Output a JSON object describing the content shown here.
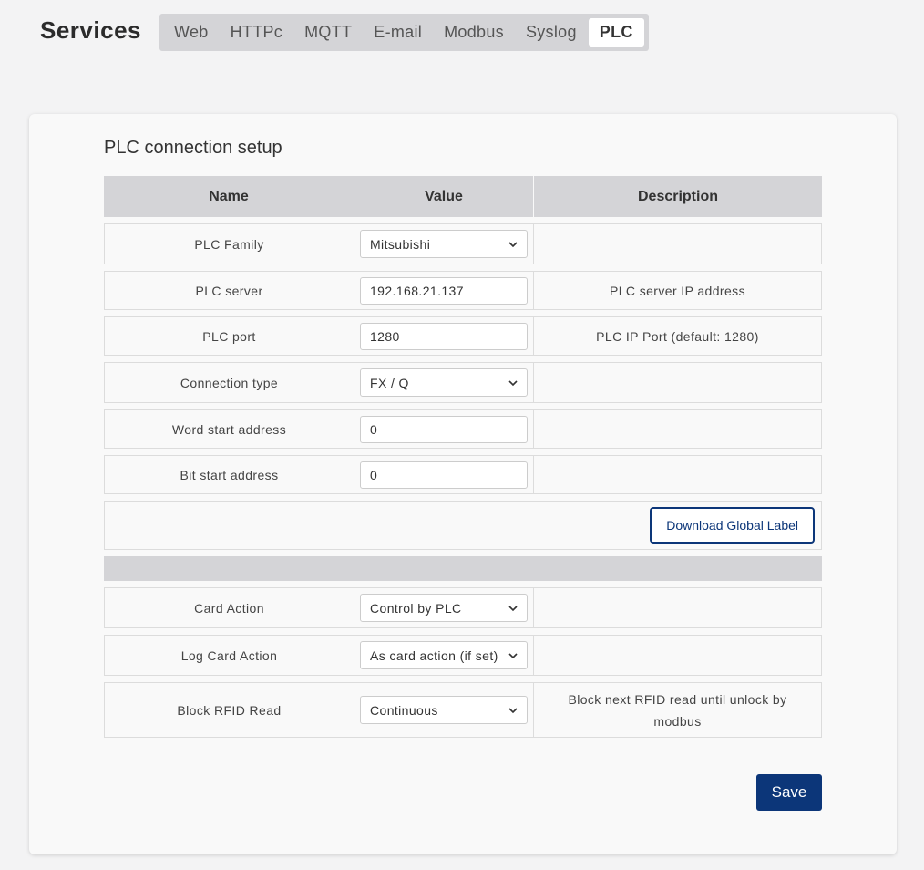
{
  "header": {
    "title": "Services",
    "tabs": [
      {
        "label": "Web"
      },
      {
        "label": "HTTPc"
      },
      {
        "label": "MQTT"
      },
      {
        "label": "E-mail"
      },
      {
        "label": "Modbus"
      },
      {
        "label": "Syslog"
      },
      {
        "label": "PLC",
        "active": true
      }
    ]
  },
  "section": {
    "title": "PLC connection setup",
    "columns": {
      "name": "Name",
      "value": "Value",
      "description": "Description"
    },
    "rows": [
      {
        "name": "PLC Family",
        "type": "select",
        "value": "Mitsubishi",
        "description": ""
      },
      {
        "name": "PLC server",
        "type": "input",
        "value": "192.168.21.137",
        "description": "PLC server IP address"
      },
      {
        "name": "PLC port",
        "type": "input",
        "value": "1280",
        "description": "PLC IP Port (default: 1280)"
      },
      {
        "name": "Connection type",
        "type": "select",
        "value": "FX / Q",
        "description": ""
      },
      {
        "name": "Word start address",
        "type": "input",
        "value": "0",
        "description": ""
      },
      {
        "name": "Bit start address",
        "type": "input",
        "value": "0",
        "description": ""
      }
    ],
    "download_label": "Download Global Label",
    "rows2": [
      {
        "name": "Card Action",
        "type": "select",
        "value": "Control by PLC",
        "description": ""
      },
      {
        "name": "Log Card Action",
        "type": "select",
        "value": "As card action (if set)",
        "description": ""
      },
      {
        "name": "Block RFID Read",
        "type": "select",
        "value": "Continuous",
        "description": "Block next RFID read until unlock by modbus"
      }
    ]
  },
  "save_label": "Save",
  "colors": {
    "primary": "#0c3679",
    "header_bg": "#d4d4d7",
    "page_bg": "#f3f3f4"
  }
}
